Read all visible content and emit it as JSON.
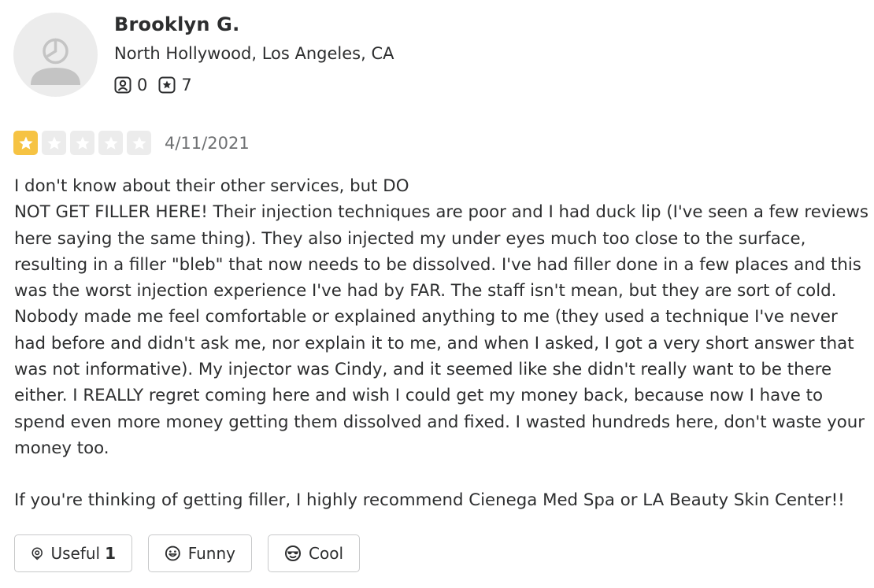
{
  "user": {
    "name": "Brooklyn G.",
    "location": "North Hollywood, Los Angeles, CA",
    "friends_count": "0",
    "reviews_count": "7"
  },
  "review": {
    "rating": 1,
    "max_rating": 5,
    "date": "4/11/2021",
    "paragraphs": [
      "I don't know about their other services, but DO\nNOT GET FILLER HERE! Their injection techniques are poor and I had duck lip (I've seen a few reviews here saying the same thing). They also injected my under eyes much too close to the surface, resulting in a filler \"bleb\" that now needs to be dissolved. I've had filler done in a few places and this was the worst injection experience I've had by FAR. The staff isn't mean, but they are sort of cold. Nobody made me feel comfortable or explained anything to me (they used a technique I've never had before and didn't ask me, nor explain it to me, and when I asked, I got a very short answer that was not informative). My injector was Cindy, and it seemed like she didn't really want to be there either. I REALLY regret coming here and wish I could get my money back, because now I have to spend even more money getting them dissolved and fixed. I wasted hundreds here, don't waste your money too.",
      "If you're thinking of getting filler, I highly recommend Cienega Med Spa or LA Beauty Skin Center!!"
    ]
  },
  "reactions": {
    "useful_label": "Useful",
    "useful_count": "1",
    "funny_label": "Funny",
    "cool_label": "Cool"
  },
  "colors": {
    "star_filled": "#f6c343",
    "star_empty": "#ececec",
    "text": "#2d2e2f",
    "muted": "#6e7072"
  },
  "icons": {
    "friends": "friends-icon",
    "reviews": "reviews-icon",
    "useful": "location-pin-icon",
    "funny": "smile-icon",
    "cool": "sunglasses-icon"
  }
}
